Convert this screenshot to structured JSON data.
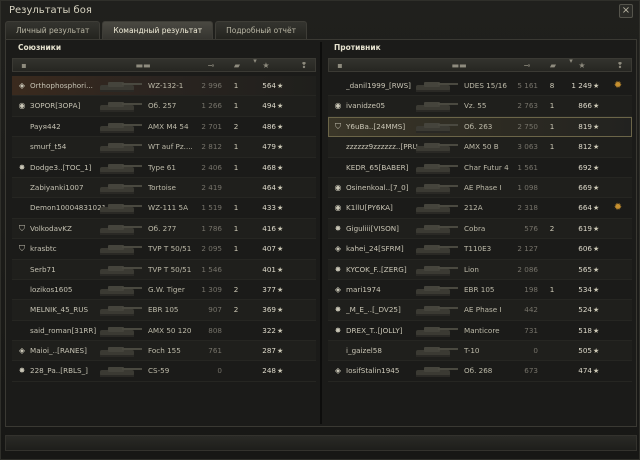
{
  "window": {
    "title": "Результаты боя",
    "close_glyph": "×"
  },
  "tabs": [
    {
      "label": "Личный результат"
    },
    {
      "label": "Командный результат",
      "active": true
    },
    {
      "label": "Подробный отчёт"
    }
  ],
  "header_icons": {
    "chat": "chat-icon",
    "tank": "tank-type-icon",
    "damage": "damage-icon",
    "kills": "kills-icon",
    "xp": "experience-star-icon",
    "sort": "sort-arrow-icon",
    "medal": "medal-icon"
  },
  "colors": {
    "highlight_row": "#3a3628",
    "top_row": "#3a2a1e",
    "medal": "#c6902f"
  },
  "allies": {
    "title": "Союзники",
    "rows": [
      {
        "badge": "◈",
        "player": "Orthophosphori...",
        "tank": "WZ-132-1",
        "damage": "2 996",
        "kills": "1",
        "xp": "564",
        "star": "★",
        "style": "top"
      },
      {
        "badge": "◉",
        "player": "ЗОРОR[ЗОРА]",
        "tank": "Об. 257",
        "damage": "1 266",
        "kills": "1",
        "xp": "494",
        "star": "★"
      },
      {
        "badge": "",
        "player": "Payя442",
        "tank": "AMX M4 54",
        "damage": "2 701",
        "kills": "2",
        "xp": "486",
        "star": "★"
      },
      {
        "badge": "",
        "player": "smurf_t54",
        "tank": "WT auf Pz....",
        "damage": "2 812",
        "kills": "1",
        "xp": "479",
        "star": "★"
      },
      {
        "badge": "✸",
        "player": "Dodge3..[TOC_1]",
        "tank": "Type 61",
        "damage": "2 406",
        "kills": "1",
        "xp": "468",
        "star": "★"
      },
      {
        "badge": "",
        "player": "Zabiyanki1007",
        "tank": "Tortoise",
        "damage": "2 419",
        "kills": "",
        "xp": "464",
        "star": "★"
      },
      {
        "badge": "",
        "player": "Demon10004831021",
        "tank": "WZ-111 5A",
        "damage": "1 519",
        "kills": "1",
        "xp": "433",
        "star": "★"
      },
      {
        "badge": "⛉",
        "player": "VolkodavKZ",
        "tank": "Об. 277",
        "damage": "1 786",
        "kills": "1",
        "xp": "416",
        "star": "★"
      },
      {
        "badge": "⛉",
        "player": "krasbtc",
        "tank": "TVP T 50/51",
        "damage": "2 095",
        "kills": "1",
        "xp": "407",
        "star": "★"
      },
      {
        "badge": "",
        "player": "Serb71",
        "tank": "TVP T 50/51",
        "damage": "1 546",
        "kills": "",
        "xp": "401",
        "star": "★"
      },
      {
        "badge": "",
        "player": "lozikos1605",
        "tank": "G.W. Tiger",
        "damage": "1 309",
        "kills": "2",
        "xp": "377",
        "star": "★"
      },
      {
        "badge": "",
        "player": "MELNIK_45_RUS",
        "tank": "EBR 105",
        "damage": "907",
        "kills": "2",
        "xp": "369",
        "star": "★"
      },
      {
        "badge": "",
        "player": "said_roman[31RR]",
        "tank": "AMX 50 120",
        "damage": "808",
        "kills": "",
        "xp": "322",
        "star": "★"
      },
      {
        "badge": "◈",
        "player": "Maioi_..[RANES]",
        "tank": "Foch 155",
        "damage": "761",
        "kills": "",
        "xp": "287",
        "star": "★"
      },
      {
        "badge": "✸",
        "player": "228_Pa..[RBLS_]",
        "tank": "CS-59",
        "damage": "0",
        "kills": "",
        "xp": "248",
        "star": "★"
      }
    ]
  },
  "enemies": {
    "title": "Противник",
    "rows": [
      {
        "badge": "",
        "player": "_danil1999_[RWS]",
        "tank": "UDES 15/16",
        "damage": "5 161",
        "kills": "8",
        "xp": "1 249",
        "star": "★",
        "medal": "✹"
      },
      {
        "badge": "◉",
        "player": "ivanidze05",
        "tank": "Vz. 55",
        "damage": "2 763",
        "kills": "1",
        "xp": "866",
        "star": "★"
      },
      {
        "badge": "⛉",
        "player": "Y6uBa..[24MMS]",
        "tank": "Об. 263",
        "damage": "2 750",
        "kills": "1",
        "xp": "819",
        "star": "★",
        "style": "me"
      },
      {
        "badge": "",
        "player": "zzzzzz9zzzzzz..[PRUD]",
        "tank": "AMX 50 B",
        "damage": "3 063",
        "kills": "1",
        "xp": "812",
        "star": "★"
      },
      {
        "badge": "",
        "player": "KEDR_65[BABER]",
        "tank": "Char Futur 4",
        "damage": "1 561",
        "kills": "",
        "xp": "692",
        "star": "★"
      },
      {
        "badge": "◉",
        "player": "Osinenkoal..[7_0]",
        "tank": "AE Phase I",
        "damage": "1 098",
        "kills": "",
        "xp": "669",
        "star": "★"
      },
      {
        "badge": "◉",
        "player": "K1llU[PY6KA]",
        "tank": "212A",
        "damage": "2 318",
        "kills": "",
        "xp": "664",
        "star": "★",
        "medal": "✹"
      },
      {
        "badge": "✸",
        "player": "Giguliii[VISON]",
        "tank": "Cobra",
        "damage": "576",
        "kills": "2",
        "xp": "619",
        "star": "★"
      },
      {
        "badge": "◈",
        "player": "kahei_24[SFRM]",
        "tank": "T110E3",
        "damage": "2 127",
        "kills": "",
        "xp": "606",
        "star": "★"
      },
      {
        "badge": "✸",
        "player": "KYCOK_F..[ZERG]",
        "tank": "Lion",
        "damage": "2 086",
        "kills": "",
        "xp": "565",
        "star": "★"
      },
      {
        "badge": "◈",
        "player": "mari1974",
        "tank": "EBR 105",
        "damage": "198",
        "kills": "1",
        "xp": "534",
        "star": "★"
      },
      {
        "badge": "✸",
        "player": "_M_E_..[_DV25]",
        "tank": "AE Phase I",
        "damage": "442",
        "kills": "",
        "xp": "524",
        "star": "★"
      },
      {
        "badge": "✸",
        "player": "DREX_T..[JOLLY]",
        "tank": "Manticore",
        "damage": "731",
        "kills": "",
        "xp": "518",
        "star": "★"
      },
      {
        "badge": "",
        "player": "i_gaizel58",
        "tank": "T-10",
        "damage": "0",
        "kills": "",
        "xp": "505",
        "star": "★"
      },
      {
        "badge": "◈",
        "player": "IosifStalin1945",
        "tank": "Об. 268",
        "damage": "673",
        "kills": "",
        "xp": "474",
        "star": "★"
      }
    ]
  }
}
